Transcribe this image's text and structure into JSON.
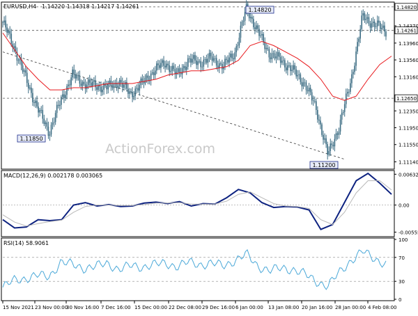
{
  "symbol_header": {
    "symbol": "EURUSD,H4",
    "ohlc": "1.14220 1.14318 1.14217 1.14261"
  },
  "watermark": "ActionForex.com",
  "price_panel": {
    "y_ticks": [
      "1.14370",
      "1.13960",
      "1.13560",
      "1.13160",
      "1.12350",
      "1.11950",
      "1.11550",
      "1.11140"
    ],
    "tags": [
      "1.14820",
      "1.14261",
      "1.12650"
    ],
    "annotations": [
      "1.14820",
      "1.11850",
      "1.11200"
    ]
  },
  "macd_panel": {
    "label": "MACD(12,26,9) 0.002178 0.003065",
    "y_ticks": [
      "0.006325",
      "0.00",
      "-0.005559"
    ]
  },
  "rsi_panel": {
    "label": "RSI(14) 58.9061",
    "y_ticks": [
      "100",
      "70",
      "30",
      "0"
    ]
  },
  "x_ticks": [
    "15 Nov 2021",
    "23 Nov 00:00",
    "30 Nov 16:00",
    "7 Dec 16:00",
    "15 Dec 00:00",
    "22 Dec 08:00",
    "29 Dec 16:00",
    "6 Jan 00:00",
    "13 Jan 08:00",
    "20 Jan 16:00",
    "28 Jan 00:00",
    "4 Feb 08:00"
  ],
  "colors": {
    "candles": "#3a6b82",
    "moving_average": "#e8191d",
    "macd_main": "#0d2280",
    "macd_signal": "#b8b8b8",
    "rsi": "#4aa8d8",
    "axis": "#000000"
  },
  "chart_data": [
    {
      "type": "candlestick",
      "title": "EURUSD,H4",
      "ylim": [
        1.11,
        1.149
      ],
      "x": [
        "15 Nov 2021",
        "23 Nov 00:00",
        "30 Nov 16:00",
        "7 Dec 16:00",
        "15 Dec 00:00",
        "22 Dec 08:00",
        "29 Dec 16:00",
        "6 Jan 00:00",
        "13 Jan 08:00",
        "20 Jan 16:00",
        "28 Jan 00:00",
        "4 Feb 08:00"
      ],
      "close_path": [
        1.1445,
        1.1385,
        1.131,
        1.124,
        1.1185,
        1.126,
        1.132,
        1.13,
        1.1295,
        1.129,
        1.1305,
        1.1275,
        1.13,
        1.133,
        1.135,
        1.132,
        1.1355,
        1.135,
        1.136,
        1.134,
        1.1375,
        1.148,
        1.142,
        1.137,
        1.1355,
        1.133,
        1.13,
        1.124,
        1.113,
        1.12,
        1.131,
        1.146,
        1.144,
        1.1426
      ],
      "moving_average": [
        1.142,
        1.138,
        1.134,
        1.131,
        1.1285,
        1.1285,
        1.129,
        1.129,
        1.1295,
        1.13,
        1.13,
        1.13,
        1.1305,
        1.131,
        1.132,
        1.1325,
        1.133,
        1.133,
        1.1335,
        1.134,
        1.1355,
        1.139,
        1.14,
        1.139,
        1.1375,
        1.136,
        1.134,
        1.131,
        1.127,
        1.126,
        1.127,
        1.131,
        1.1345,
        1.1365
      ],
      "trendline": [
        [
          0,
          1.1375
        ],
        [
          0.88,
          1.112
        ]
      ],
      "levels": [
        1.1482,
        1.14261,
        1.1265
      ],
      "labeled_points": [
        {
          "label": "1.14820",
          "price": 1.1482
        },
        {
          "label": "1.11850",
          "price": 1.1185
        },
        {
          "label": "1.11200",
          "price": 1.112
        }
      ]
    },
    {
      "type": "line",
      "title": "MACD(12,26,9) 0.002178 0.003065",
      "ylim": [
        -0.0062,
        0.0068
      ],
      "series": [
        {
          "name": "MACD",
          "values": [
            -0.003,
            -0.0047,
            -0.0045,
            -0.003,
            -0.0032,
            -0.003,
            0.0,
            0.0005,
            -0.0002,
            0.0001,
            -0.0003,
            -0.0002,
            0.0004,
            0.0006,
            0.0003,
            0.0007,
            -0.0002,
            0.0003,
            0.0002,
            0.0015,
            0.0032,
            0.0025,
            0.0005,
            -0.0005,
            -0.0003,
            -0.0004,
            -0.001,
            -0.005,
            -0.004,
            0.0005,
            0.005,
            0.0065,
            0.0045,
            0.0022
          ]
        },
        {
          "name": "Signal",
          "values": [
            -0.002,
            -0.0035,
            -0.0043,
            -0.0038,
            -0.0034,
            -0.0031,
            -0.0015,
            -0.0003,
            0.0,
            0.0,
            -0.0001,
            -0.0001,
            0.0001,
            0.0004,
            0.0004,
            0.0005,
            0.0002,
            0.0002,
            0.0002,
            0.0008,
            0.0022,
            0.0027,
            0.0015,
            0.0003,
            -0.0002,
            -0.0003,
            -0.0007,
            -0.003,
            -0.004,
            -0.0015,
            0.0025,
            0.005,
            0.005,
            0.0031
          ]
        }
      ]
    },
    {
      "type": "line",
      "title": "RSI(14) 58.9061",
      "ylim": [
        0,
        100
      ],
      "levels": [
        70,
        30
      ],
      "values": [
        20,
        32,
        35,
        40,
        38,
        62,
        58,
        52,
        55,
        60,
        50,
        56,
        54,
        58,
        60,
        55,
        62,
        58,
        60,
        56,
        65,
        75,
        55,
        48,
        52,
        50,
        42,
        30,
        22,
        45,
        65,
        80,
        68,
        59
      ]
    }
  ]
}
